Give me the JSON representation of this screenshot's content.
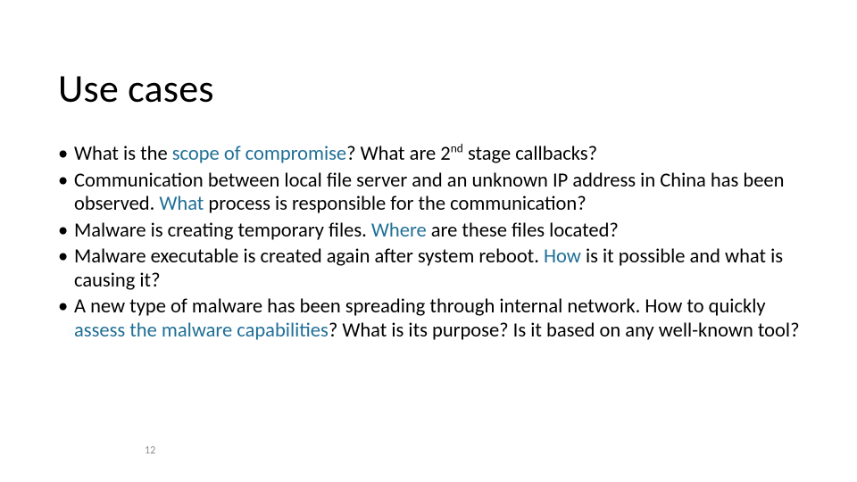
{
  "title": "Use cases",
  "bullets": [
    {
      "seg": [
        {
          "t": "What is the "
        },
        {
          "t": "scope of compromise",
          "hl": true
        },
        {
          "t": "? What are 2"
        },
        {
          "t": "nd",
          "sup": true
        },
        {
          "t": " stage callbacks?"
        }
      ]
    },
    {
      "seg": [
        {
          "t": "Communication between local file server and an unknown IP address in China has been observed. "
        },
        {
          "t": "What",
          "hl": true
        },
        {
          "t": " process is responsible for the communication?"
        }
      ]
    },
    {
      "seg": [
        {
          "t": "Malware is creating temporary files. "
        },
        {
          "t": "Where",
          "hl": true
        },
        {
          "t": " are these files located?"
        }
      ]
    },
    {
      "seg": [
        {
          "t": "Malware executable is created again after system reboot. "
        },
        {
          "t": "How",
          "hl": true
        },
        {
          "t": " is it possible and what is causing it?"
        }
      ]
    },
    {
      "seg": [
        {
          "t": "A new type of malware has been spreading through internal network. How to quickly "
        },
        {
          "t": "assess the malware capabilities",
          "hl": true
        },
        {
          "t": "? What is its purpose? Is it based on any well-known tool?"
        }
      ]
    }
  ],
  "page_number": "12"
}
